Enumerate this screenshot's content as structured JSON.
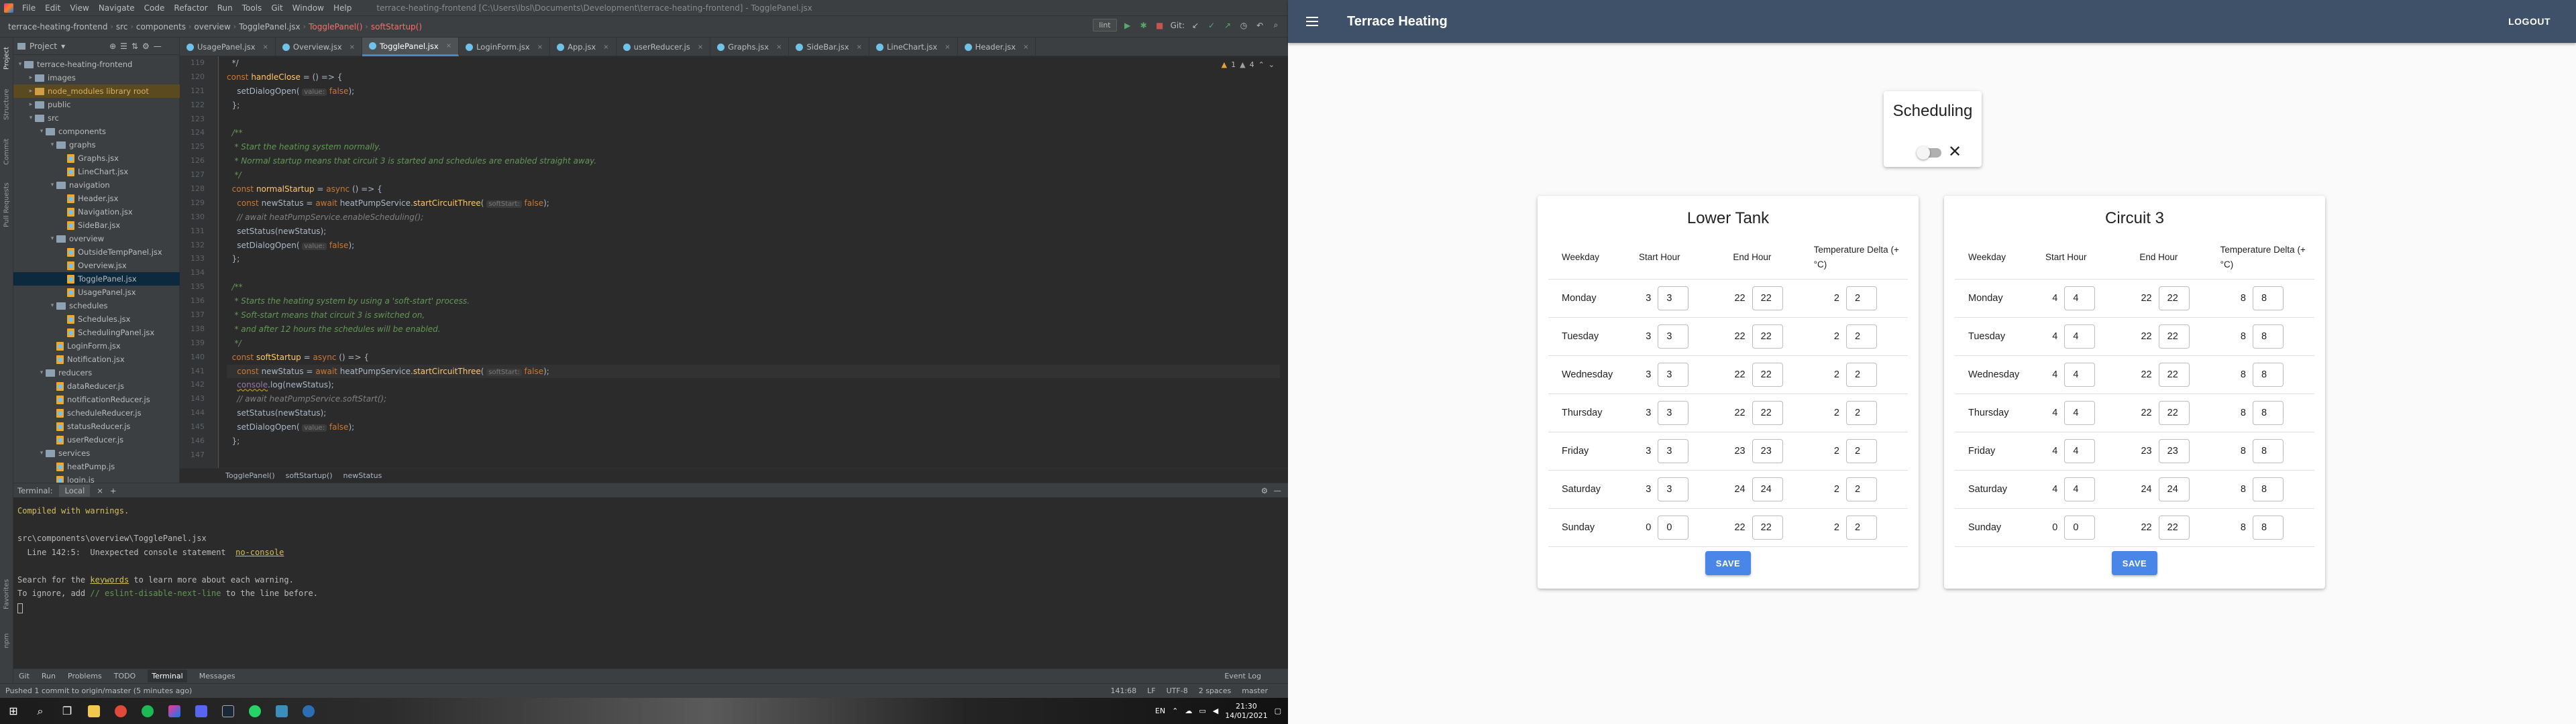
{
  "ide": {
    "menu": [
      "File",
      "Edit",
      "View",
      "Navigate",
      "Code",
      "Refactor",
      "Run",
      "Tools",
      "Git",
      "Window",
      "Help"
    ],
    "window_title": "terrace-heating-frontend [C:\\Users\\lbsl\\Documents\\Development\\terrace-heating-frontend] - TogglePanel.jsx",
    "nav_crumbs": [
      "terrace-heating-frontend",
      "src",
      "components",
      "overview",
      "TogglePanel.jsx",
      "TogglePanel()",
      "softStartup()"
    ],
    "run_config": "lint",
    "git_label": "Git:",
    "project_title": "Project",
    "tree": [
      {
        "label": "terrace-heating-frontend",
        "depth": 0,
        "type": "folder",
        "open": true
      },
      {
        "label": "images",
        "depth": 1,
        "type": "folder"
      },
      {
        "label": "node_modules  library root",
        "depth": 1,
        "type": "folder-orange",
        "excluded": true
      },
      {
        "label": "public",
        "depth": 1,
        "type": "folder"
      },
      {
        "label": "src",
        "depth": 1,
        "type": "folder",
        "open": true
      },
      {
        "label": "components",
        "depth": 2,
        "type": "folder",
        "open": true
      },
      {
        "label": "graphs",
        "depth": 3,
        "type": "folder",
        "open": true
      },
      {
        "label": "Graphs.jsx",
        "depth": 4,
        "type": "file"
      },
      {
        "label": "LineChart.jsx",
        "depth": 4,
        "type": "file"
      },
      {
        "label": "navigation",
        "depth": 3,
        "type": "folder",
        "open": true
      },
      {
        "label": "Header.jsx",
        "depth": 4,
        "type": "file"
      },
      {
        "label": "Navigation.jsx",
        "depth": 4,
        "type": "file"
      },
      {
        "label": "SideBar.jsx",
        "depth": 4,
        "type": "file"
      },
      {
        "label": "overview",
        "depth": 3,
        "type": "folder",
        "open": true
      },
      {
        "label": "OutsideTempPanel.jsx",
        "depth": 4,
        "type": "file"
      },
      {
        "label": "Overview.jsx",
        "depth": 4,
        "type": "file"
      },
      {
        "label": "TogglePanel.jsx",
        "depth": 4,
        "type": "file",
        "selected": true
      },
      {
        "label": "UsagePanel.jsx",
        "depth": 4,
        "type": "file"
      },
      {
        "label": "schedules",
        "depth": 3,
        "type": "folder",
        "open": true
      },
      {
        "label": "Schedules.jsx",
        "depth": 4,
        "type": "file"
      },
      {
        "label": "SchedulingPanel.jsx",
        "depth": 4,
        "type": "file"
      },
      {
        "label": "LoginForm.jsx",
        "depth": 3,
        "type": "file"
      },
      {
        "label": "Notification.jsx",
        "depth": 3,
        "type": "file"
      },
      {
        "label": "reducers",
        "depth": 2,
        "type": "folder",
        "open": true
      },
      {
        "label": "dataReducer.js",
        "depth": 3,
        "type": "file"
      },
      {
        "label": "notificationReducer.js",
        "depth": 3,
        "type": "file"
      },
      {
        "label": "scheduleReducer.js",
        "depth": 3,
        "type": "file"
      },
      {
        "label": "statusReducer.js",
        "depth": 3,
        "type": "file"
      },
      {
        "label": "userReducer.js",
        "depth": 3,
        "type": "file"
      },
      {
        "label": "services",
        "depth": 2,
        "type": "folder",
        "open": true
      },
      {
        "label": "heatPump.js",
        "depth": 3,
        "type": "file"
      },
      {
        "label": "login.js",
        "depth": 3,
        "type": "file"
      }
    ],
    "editor_tabs": [
      "UsagePanel.jsx",
      "Overview.jsx",
      "TogglePanel.jsx",
      "LoginForm.jsx",
      "App.jsx",
      "userReducer.js",
      "Graphs.jsx",
      "SideBar.jsx",
      "LineChart.jsx",
      "Header.jsx"
    ],
    "active_tab": "TogglePanel.jsx",
    "warnings": {
      "warn": "1",
      "weak": "4"
    },
    "line_numbers": [
      "119",
      "120",
      "121",
      "122",
      "123",
      "124",
      "125",
      "126",
      "127",
      "128",
      "129",
      "130",
      "131",
      "132",
      "133",
      "134",
      "135",
      "136",
      "137",
      "138",
      "139",
      "140",
      "141",
      "142",
      "143",
      "144",
      "145",
      "146",
      "147"
    ],
    "editor_breadcrumb": [
      "TogglePanel()",
      "softStartup()",
      "newStatus"
    ],
    "terminal_tabs": [
      "Terminal:",
      "Local"
    ],
    "terminal_lines": [
      {
        "text": "Compiled with warnings.",
        "cls": "t-warn"
      },
      {
        "text": "",
        "cls": ""
      },
      {
        "text": "src\\components\\overview\\TogglePanel.jsx",
        "cls": ""
      },
      {
        "text": "  Line 142:5:  Unexpected console statement  ",
        "cls": "",
        "link": "no-console"
      },
      {
        "text": "",
        "cls": ""
      },
      {
        "text": "Search for the ",
        "cls": "",
        "link": "keywords",
        "after": " to learn more about each warning."
      },
      {
        "text": "To ignore, add ",
        "cls": "",
        "cm": "// eslint-disable-next-line",
        "after": " to the line before."
      }
    ],
    "tool_buttons": [
      "Git",
      "Run",
      "Problems",
      "TODO",
      "Terminal",
      "Messages"
    ],
    "active_tool": "Terminal",
    "event_log": "Event Log",
    "status_left": "Pushed 1 commit to origin/master (5 minutes ago)",
    "status_right": [
      "141:68",
      "LF",
      "UTF-8",
      "2 spaces",
      "master"
    ],
    "taskbar": {
      "lang": "EN",
      "time": "21:30",
      "date": "14/01/2021"
    }
  },
  "app": {
    "brand": "Terrace Heating",
    "logout": "LOGOUT",
    "scheduling_title": "Scheduling",
    "columns": [
      "Weekday",
      "Start Hour",
      "End Hour",
      "Temperature Delta (+ °C)"
    ],
    "save_label": "SAVE",
    "panels": [
      {
        "title": "Lower Tank",
        "rows": [
          {
            "day": "Monday",
            "start": "3",
            "end": "22",
            "delta": "2"
          },
          {
            "day": "Tuesday",
            "start": "3",
            "end": "22",
            "delta": "2"
          },
          {
            "day": "Wednesday",
            "start": "3",
            "end": "22",
            "delta": "2"
          },
          {
            "day": "Thursday",
            "start": "3",
            "end": "22",
            "delta": "2"
          },
          {
            "day": "Friday",
            "start": "3",
            "end": "23",
            "delta": "2"
          },
          {
            "day": "Saturday",
            "start": "3",
            "end": "24",
            "delta": "2"
          },
          {
            "day": "Sunday",
            "start": "0",
            "end": "22",
            "delta": "2"
          }
        ]
      },
      {
        "title": "Circuit 3",
        "rows": [
          {
            "day": "Monday",
            "start": "4",
            "end": "22",
            "delta": "8"
          },
          {
            "day": "Tuesday",
            "start": "4",
            "end": "22",
            "delta": "8"
          },
          {
            "day": "Wednesday",
            "start": "4",
            "end": "22",
            "delta": "8"
          },
          {
            "day": "Thursday",
            "start": "4",
            "end": "22",
            "delta": "8"
          },
          {
            "day": "Friday",
            "start": "4",
            "end": "23",
            "delta": "8"
          },
          {
            "day": "Saturday",
            "start": "4",
            "end": "24",
            "delta": "8"
          },
          {
            "day": "Sunday",
            "start": "0",
            "end": "22",
            "delta": "8"
          }
        ]
      }
    ]
  }
}
